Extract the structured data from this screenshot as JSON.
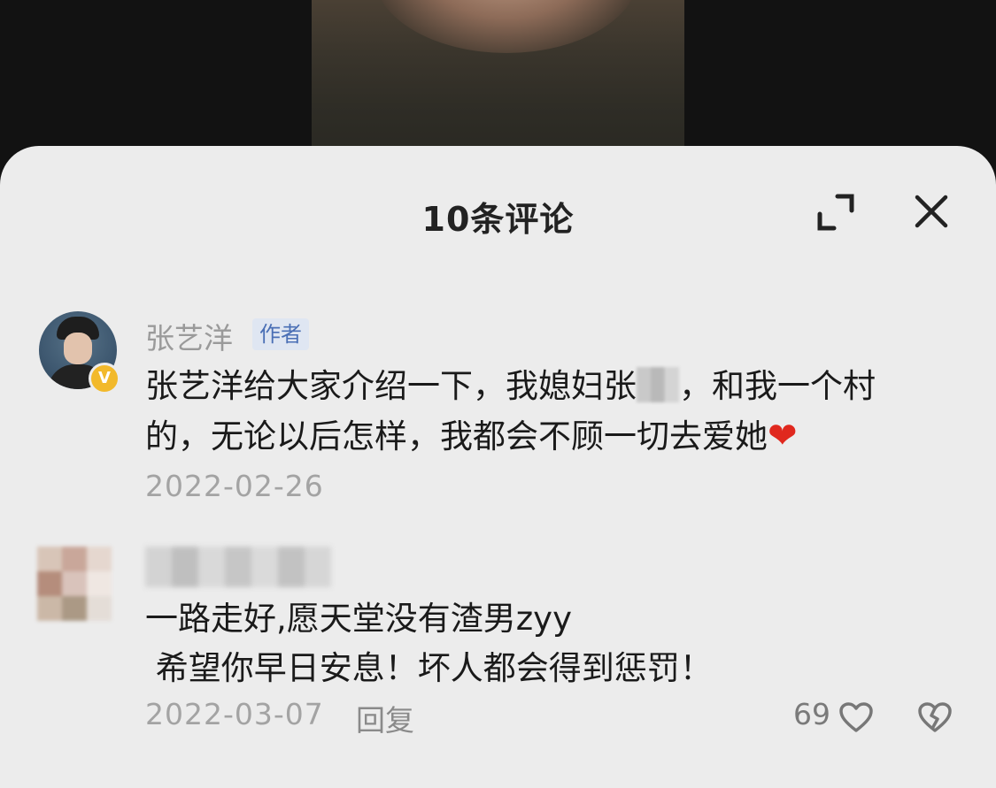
{
  "header": {
    "title": "10条评论",
    "expand_icon": "expand-icon",
    "close_icon": "close-icon"
  },
  "comments": [
    {
      "username": "张艺洋",
      "tag": "作者",
      "verified_badge": "V",
      "text_line1_before": "张艺洋给大家介绍一下，我媳妇张",
      "text_line1_after": "，和我一个村",
      "text_line2": "的，无论以后怎样，我都会不顾一切去爱她",
      "emoji": "❤",
      "date": "2022-02-26"
    },
    {
      "text_line1": "一路走好,愿天堂没有渣男zyy",
      "text_line2": " 希望你早日安息！坏人都会得到惩罚！",
      "date": "2022-03-07",
      "reply_label": "回复",
      "likes": "69",
      "like_icon": "heart-outline-icon",
      "dislike_icon": "broken-heart-icon"
    }
  ],
  "colors": {
    "sheet_bg": "#ececec",
    "author_tag_text": "#4a6fb5",
    "badge": "#f2b92b",
    "heart": "#e0281e"
  }
}
